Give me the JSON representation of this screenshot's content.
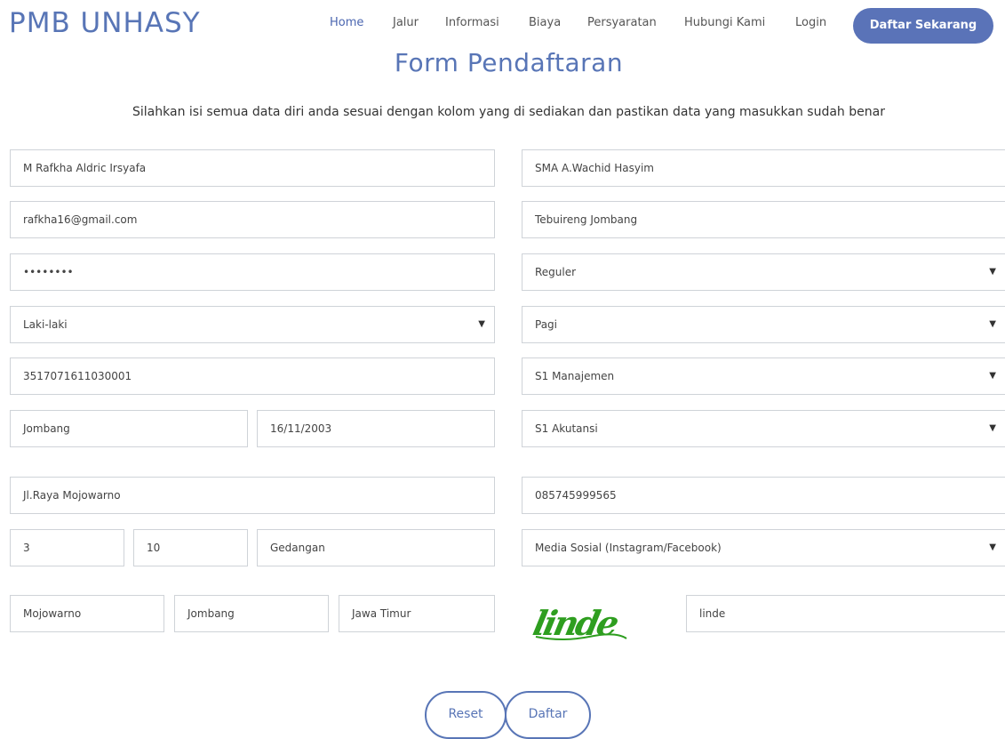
{
  "header": {
    "brand": "PMB UNHASY",
    "nav": [
      {
        "label": "Home"
      },
      {
        "label": "Jalur"
      },
      {
        "label": "Informasi"
      },
      {
        "label": "Biaya"
      },
      {
        "label": "Persyaratan"
      },
      {
        "label": "Hubungi Kami"
      },
      {
        "label": "Login"
      }
    ],
    "cta_label": "Daftar Sekarang"
  },
  "page": {
    "title": "Form Pendaftaran",
    "subtitle": "Silahkan isi semua data diri anda sesuai dengan kolom yang di sediakan dan pastikan data yang masukkan sudah benar"
  },
  "form": {
    "nama": "M Rafkha Aldric Irsyafa",
    "email": "rafkha16@gmail.com",
    "password": "••••••••",
    "jenis_kelamin": "Laki-laki",
    "nik": "3517071611030001",
    "tempat_lahir": "Jombang",
    "tanggal_lahir": "16/11/2003",
    "alamat": "Jl.Raya Mojowarno",
    "rt": "3",
    "rw": "10",
    "desa": "Gedangan",
    "kecamatan": "Mojowarno",
    "kabupaten": "Jombang",
    "provinsi": "Jawa Timur",
    "asal_sekolah": "SMA A.Wachid Hasyim",
    "alamat_sekolah": "Tebuireng Jombang",
    "jalur": "Reguler",
    "waktu_kuliah": "Pagi",
    "prodi_1": "S1 Manajemen",
    "prodi_2": "S1 Akutansi",
    "telepon": "085745999565",
    "sumber_info": "Media Sosial (Instagram/Facebook)",
    "captcha_text": "linde",
    "captcha_input": "linde"
  },
  "actions": {
    "reset_label": "Reset",
    "submit_label": "Daftar"
  },
  "colors": {
    "accent": "#5875b6",
    "captcha": "#2e9e1f"
  },
  "icons": {
    "dropdown": "chevron-down-icon"
  }
}
